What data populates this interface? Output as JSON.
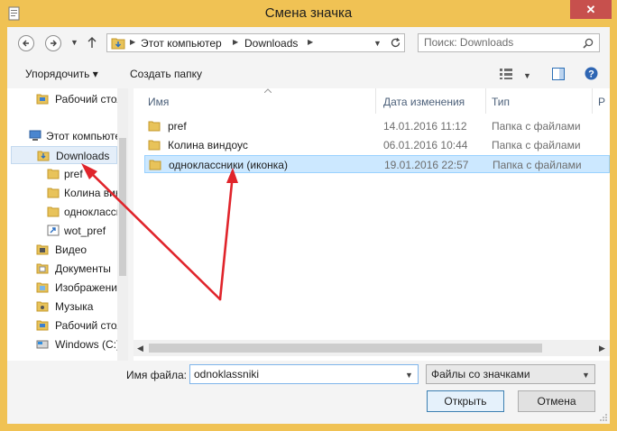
{
  "window": {
    "title": "Смена значка",
    "close_label": "✕"
  },
  "address": {
    "segments": [
      "Этот компьютер",
      "Downloads"
    ],
    "search_placeholder": "Поиск: Downloads"
  },
  "toolbar": {
    "organize_label": "Упорядочить ▾",
    "new_folder_label": "Создать папку"
  },
  "nav_tree": [
    {
      "label": "Рабочий стол",
      "icon": "desktop-folder-icon"
    },
    {
      "label": "Этот компьютер",
      "icon": "computer-icon"
    },
    {
      "label": "Downloads",
      "icon": "downloads-folder-icon",
      "selected": true
    },
    {
      "label": "pref",
      "icon": "folder-icon"
    },
    {
      "label": "Колина виндоус",
      "icon": "folder-icon"
    },
    {
      "label": "одноклассники (иконка)",
      "icon": "folder-icon"
    },
    {
      "label": "wot_pref",
      "icon": "shortcut-icon"
    },
    {
      "label": "Видео",
      "icon": "video-library-icon"
    },
    {
      "label": "Документы",
      "icon": "documents-library-icon"
    },
    {
      "label": "Изображения",
      "icon": "pictures-library-icon"
    },
    {
      "label": "Музыка",
      "icon": "music-library-icon"
    },
    {
      "label": "Рабочий стол",
      "icon": "desktop-folder-icon"
    },
    {
      "label": "Windows (C:)",
      "icon": "drive-icon"
    }
  ],
  "columns": {
    "name": "Имя",
    "date": "Дата изменения",
    "type": "Тип",
    "size": "Р"
  },
  "files": [
    {
      "name": "pref",
      "date": "14.01.2016 11:12",
      "type": "Папка с файлами"
    },
    {
      "name": "Колина виндоус",
      "date": "06.01.2016 10:44",
      "type": "Папка с файлами"
    },
    {
      "name": "одноклассники (иконка)",
      "date": "19.01.2016 22:57",
      "type": "Папка с файлами",
      "selected": true
    }
  ],
  "bottom": {
    "filename_label": "Имя файла:",
    "filename_value": "odnoklassniki",
    "filetype_value": "Файлы со значками",
    "open_label": "Открыть",
    "cancel_label": "Отмена"
  },
  "colors": {
    "titlebar": "#f0c254",
    "close": "#c7504d",
    "selection": "#cce8ff",
    "annotation_arrow": "#e0242b"
  }
}
